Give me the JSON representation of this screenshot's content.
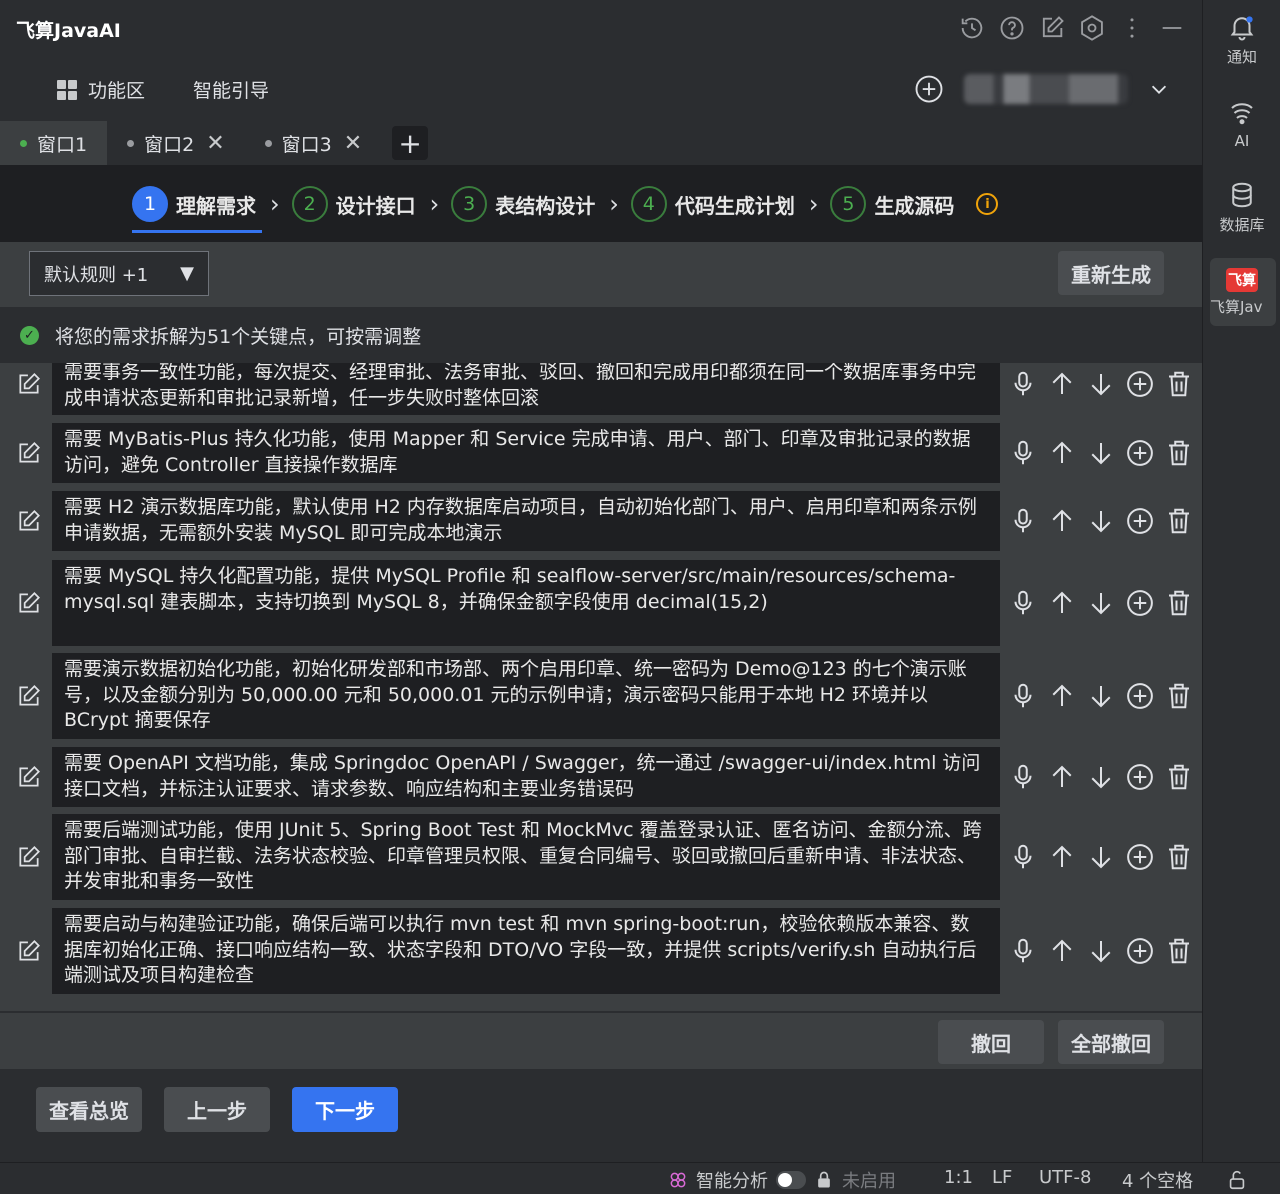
{
  "app": {
    "title": "飞算JavaAI"
  },
  "nav": {
    "feature_area": "功能区",
    "smart_guide": "智能引导"
  },
  "tabs": [
    {
      "label": "窗口1",
      "active": true
    },
    {
      "label": "窗口2",
      "closable": true
    },
    {
      "label": "窗口3",
      "closable": true
    }
  ],
  "steps": [
    {
      "num": "1",
      "label": "理解需求",
      "active": true
    },
    {
      "num": "2",
      "label": "设计接口"
    },
    {
      "num": "3",
      "label": "表结构设计"
    },
    {
      "num": "4",
      "label": "代码生成计划"
    },
    {
      "num": "5",
      "label": "生成源码"
    }
  ],
  "toolbar": {
    "rule_select": "默认规则 +1",
    "regenerate": "重新生成"
  },
  "notice": {
    "text": "将您的需求拆解为51个关键点，可按需调整"
  },
  "requirements": [
    "需要事务一致性功能，每次提交、经理审批、法务审批、驳回、撤回和完成用印都须在同一个数据库事务中完成申请状态更新和审批记录新增，任一步失败时整体回滚",
    "需要 MyBatis-Plus 持久化功能，使用 Mapper 和 Service 完成申请、用户、部门、印章及审批记录的数据访问，避免 Controller 直接操作数据库",
    "需要 H2 演示数据库功能，默认使用 H2 内存数据库启动项目，自动初始化部门、用户、启用印章和两条示例申请数据，无需额外安装 MySQL 即可完成本地演示",
    "需要 MySQL 持久化配置功能，提供 MySQL Profile 和 sealflow-server/src/main/resources/schema-mysql.sql 建表脚本，支持切换到 MySQL 8，并确保金额字段使用 decimal(15,2)",
    "需要演示数据初始化功能，初始化研发部和市场部、两个启用印章、统一密码为 Demo@123 的七个演示账号，以及金额分别为 50,000.00 元和 50,000.01 元的示例申请；演示密码只能用于本地 H2 环境并以 BCrypt 摘要保存",
    "需要 OpenAPI 文档功能，集成 Springdoc OpenAPI / Swagger，统一通过 /swagger-ui/index.html 访问接口文档，并标注认证要求、请求参数、响应结构和主要业务错误码",
    "需要后端测试功能，使用 JUnit 5、Spring Boot Test 和 MockMvc 覆盖登录认证、匿名访问、金额分流、跨部门审批、自审拦截、法务状态校验、印章管理员权限、重复合同编号、驳回或撤回后重新申请、非法状态、并发审批和事务一致性",
    "需要启动与构建验证功能，确保后端可以执行 mvn test 和 mvn spring-boot:run，校验依赖版本兼容、数据库初始化正确、接口响应结构一致、状态字段和 DTO/VO 字段一致，并提供 scripts/verify.sh 自动执行后端测试及项目构建检查"
  ],
  "list_actions": {
    "undo": "撤回",
    "undo_all": "全部撤回"
  },
  "footer": {
    "overview": "查看总览",
    "prev": "上一步",
    "next": "下一步"
  },
  "right_bar": {
    "notify": "通知",
    "ai": "AI",
    "database": "数据库",
    "plugin": "飞算Jav",
    "plugin_logo": "飞算"
  },
  "status_bar": {
    "smart_analysis": "智能分析",
    "disabled": "未启用",
    "position": "1:1",
    "line_sep": "LF",
    "encoding": "UTF-8",
    "indent": "4 个空格"
  },
  "colors": {
    "accent": "#3574f0",
    "success": "#4caf50",
    "warning": "#f0a30a"
  }
}
